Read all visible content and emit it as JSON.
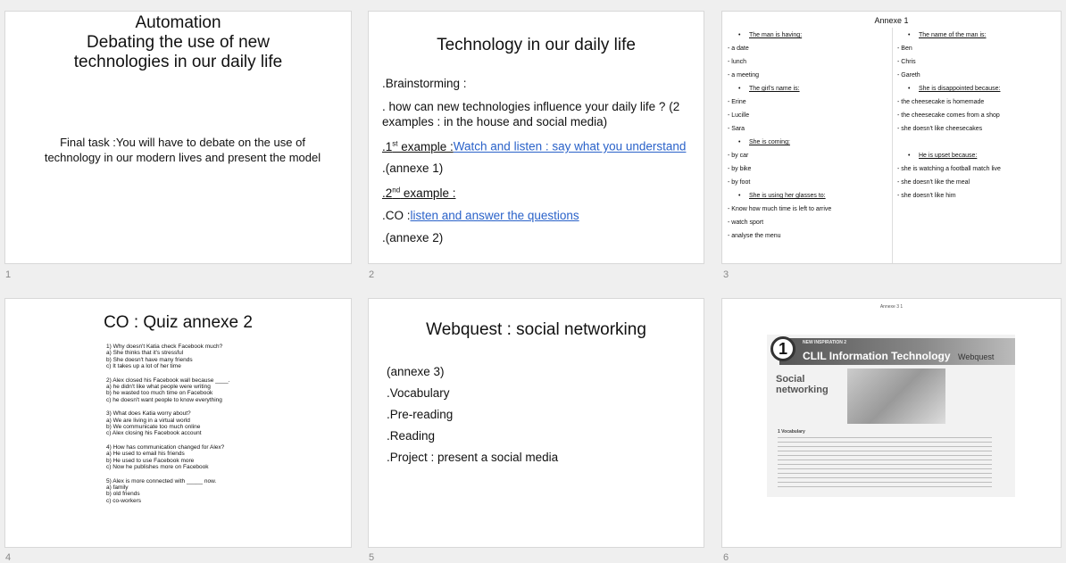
{
  "slides": [
    {
      "number": "1",
      "title_lines": [
        "Automation",
        "Debating the use of new",
        "technologies in our daily life"
      ],
      "body": "Final task :You will have to debate on the use of technology in our modern lives and present the model"
    },
    {
      "number": "2",
      "title": "Technology in our daily life",
      "items": {
        "brainstorming": ".Brainstorming :",
        "question": ". how can new technologies influence your daily life ? (2 examples : in the house and social media)",
        "ex1_prefix": ".1",
        "ex1_sup": "st",
        "ex1_label": " example :",
        "ex1_link": "Watch and listen : say what you understand",
        "annexe1": ".(annexe 1)",
        "ex2_prefix": ".2",
        "ex2_sup": "nd",
        "ex2_label": " example :",
        "co_prefix": ".CO :",
        "co_link": "listen and answer the questions",
        "annexe2": ".(annexe 2)"
      }
    },
    {
      "number": "3",
      "title": "Annexe 1",
      "left": [
        {
          "text": "The man is having:",
          "bullet": true
        },
        {
          "text": "- a date"
        },
        {
          "text": "- lunch"
        },
        {
          "text": "- a meeting"
        },
        {
          "text": "The girl's name is:",
          "bullet": true
        },
        {
          "text": "- Erine"
        },
        {
          "text": "- Lucille"
        },
        {
          "text": "- Sara"
        },
        {
          "text": "She is coming:",
          "bullet": true
        },
        {
          "text": "- by car"
        },
        {
          "text": "- by bike"
        },
        {
          "text": "- by foot"
        },
        {
          "text": "She is using her glasses to:",
          "bullet": true
        },
        {
          "text": "- Know how much time is left to arrive"
        },
        {
          "text": "- watch sport"
        },
        {
          "text": "- analyse the menu"
        }
      ],
      "right": [
        {
          "text": "The name of the man is:",
          "bullet": true
        },
        {
          "text": "- Ben"
        },
        {
          "text": "- Chris"
        },
        {
          "text": "- Gareth"
        },
        {
          "text": "She is disappointed because:",
          "bullet": true
        },
        {
          "text": "- the cheesecake is homemade"
        },
        {
          "text": "- the cheesecake comes from a shop"
        },
        {
          "text": "- she doesn't like cheesecakes"
        },
        {
          "text": ""
        },
        {
          "text": "He is upset because:",
          "bullet": true
        },
        {
          "text": "- she is watching a football match live"
        },
        {
          "text": "- she doesn't like the meal"
        },
        {
          "text": "- she doesn't like him"
        }
      ]
    },
    {
      "number": "4",
      "title": "CO : Quiz annexe 2",
      "questions": [
        [
          "1) Why doesn't Katia check Facebook much?",
          "a) She thinks that it's stressful",
          "b) She doesn't have many friends",
          "c) It takes up a lot of her time"
        ],
        [
          "2) Alex closed his Facebook wall because ____.",
          "a) he didn't like what people were writing",
          "b) he wasted too much time on Facebook",
          "c) he doesn't want people to know everything"
        ],
        [
          "3) What does Katia worry about?",
          "a) We are living in a virtual world",
          "b) We communicate too much online",
          "c) Alex closing his Facebook account"
        ],
        [
          "4) How has communication changed for Alex?",
          "a) He used to email his friends",
          "b) He used to use Facebook more",
          "c) Now he publishes more on Facebook"
        ],
        [
          "5) Alex is more connected with _____ now.",
          "a) family",
          "b) old friends",
          "c) co-workers"
        ]
      ]
    },
    {
      "number": "5",
      "title": "Webquest : social networking",
      "items": [
        "(annexe 3)",
        ".Vocabulary",
        ".Pre-reading",
        ".Reading",
        ".Project : present a social media"
      ]
    },
    {
      "number": "6",
      "title": "Annexe 3 1",
      "badge": "1",
      "series": "NEW INSPIRATION 2",
      "header": "CLIL Information Technology",
      "header_tag": "Webquest",
      "section": "Social networking",
      "vocab": "1 Vocabulary"
    }
  ],
  "colors": {
    "link": "#2a62c9",
    "background": "#efefef",
    "slide_border": "#d8d8d8"
  }
}
